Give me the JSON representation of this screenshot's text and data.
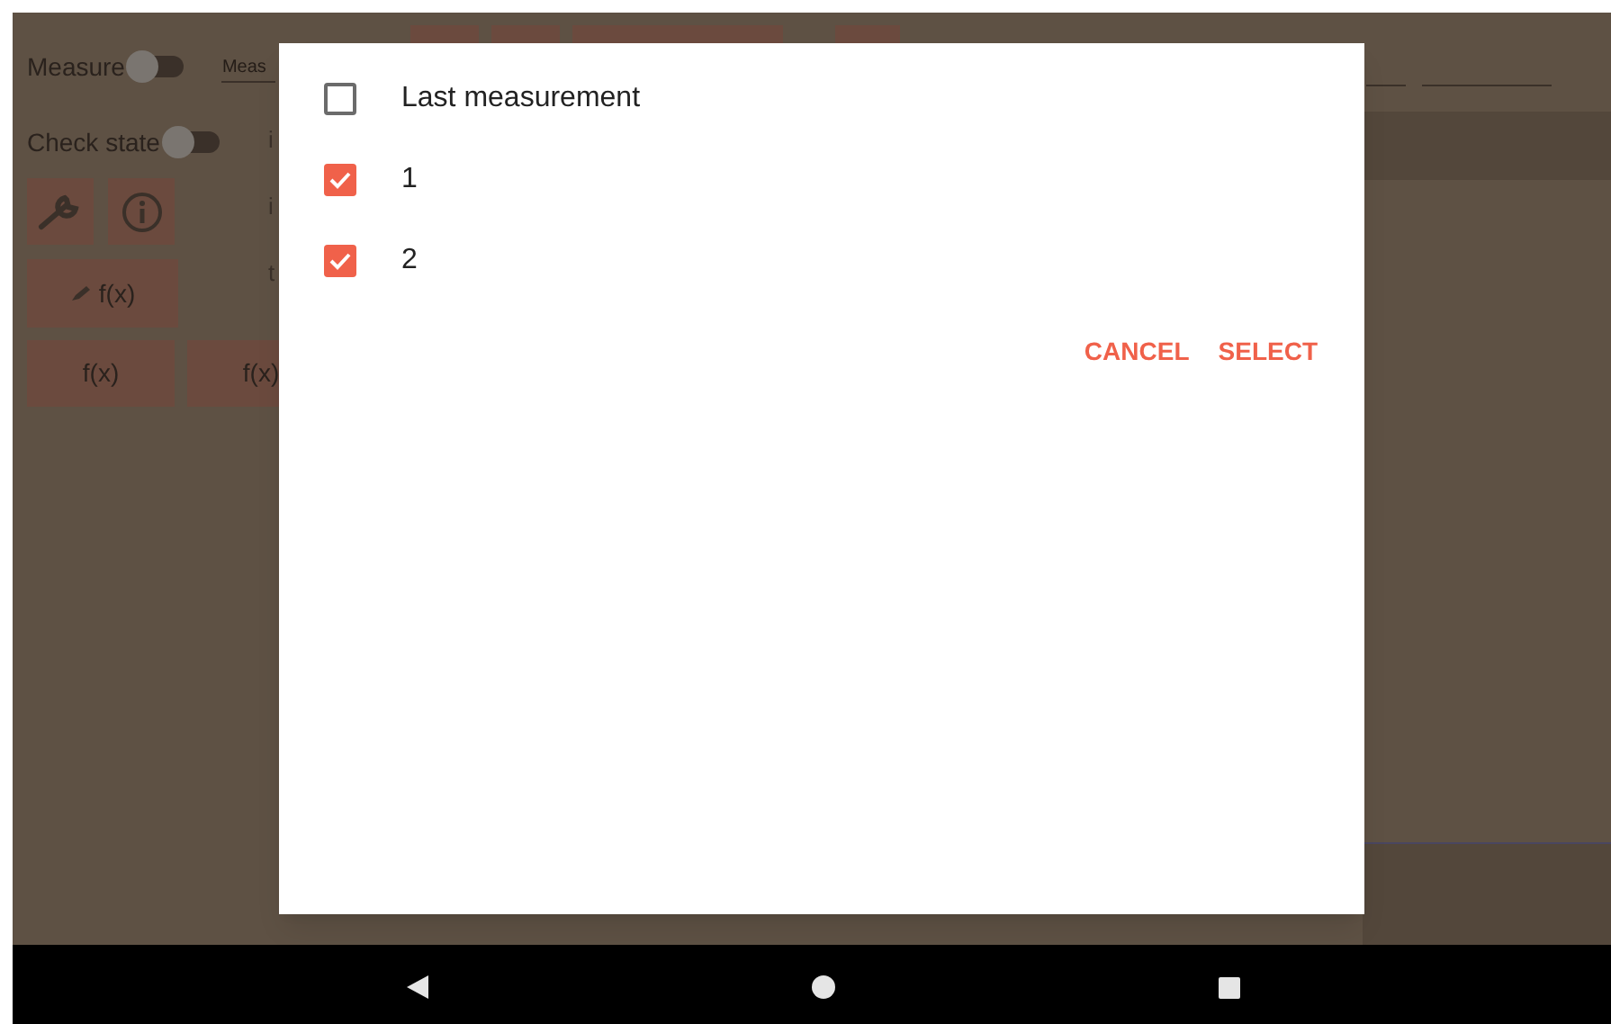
{
  "app": {
    "measure": {
      "label": "Measure",
      "on": false
    },
    "measure_field": {
      "placeholder": "Meas"
    },
    "check_state": {
      "label": "Check state",
      "on": false
    },
    "side_labels": [
      "i",
      "i",
      "t"
    ],
    "edit_function_button": "f(x)",
    "function_buttons": [
      "f(x)",
      "f(x)"
    ]
  },
  "dialog": {
    "items": [
      {
        "label": "Last measurement",
        "checked": false
      },
      {
        "label": "1",
        "checked": true
      },
      {
        "label": "2",
        "checked": true
      }
    ],
    "buttons": [
      "CANCEL",
      "SELECT"
    ]
  }
}
